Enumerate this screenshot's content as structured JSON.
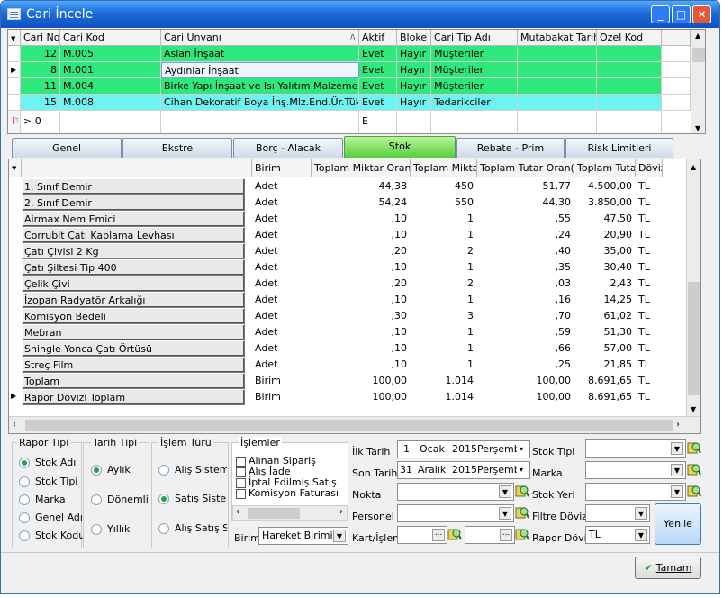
{
  "window": {
    "title": "Cari İncele",
    "minimize": "_",
    "maximize": "□",
    "close": "✕"
  },
  "top_grid": {
    "columns": [
      "Cari No",
      "Cari Kod",
      "Cari Ünvanı",
      "Aktif",
      "Bloke",
      "Cari Tip Adı",
      "Mutabakat Tarihi",
      "Özel Kod"
    ],
    "sort_indicator": "/\\",
    "rows": [
      {
        "no": "12",
        "kod": "M.005",
        "unvan": "Aslan İnşaat",
        "aktif": "Evet",
        "bloke": "Hayır",
        "tip": "Müşteriler",
        "color": "#2ee87c"
      },
      {
        "no": "8",
        "kod": "M.001",
        "unvan": "Aydınlar İnşaat",
        "aktif": "Evet",
        "bloke": "Hayır",
        "tip": "Müşteriler",
        "color": "#2ee87c"
      },
      {
        "no": "11",
        "kod": "M.004",
        "unvan": "Birke Yapı İnşaat ve Isı Yalıtım Malzemeleri",
        "aktif": "Evet",
        "bloke": "Hayır",
        "tip": "Müşteriler",
        "color": "#2ee87c"
      },
      {
        "no": "15",
        "kod": "M.008",
        "unvan": "Cihan Dekoratif Boya İnş.Mlz.End.Ür.Tük.Mal.",
        "aktif": "Evet",
        "bloke": "Hayır",
        "tip": "Tedarikciler",
        "color": "#6ff2f2"
      }
    ],
    "filter_row": {
      "no": "> 0",
      "aktif": "E"
    }
  },
  "tabs": [
    "Genel",
    "Ekstre",
    "Borç - Alacak",
    "Stok",
    "Rebate - Prim",
    "Risk Limitleri"
  ],
  "active_tab": "Stok",
  "stock_grid": {
    "columns": [
      "Birim",
      "Toplam Miktar Oran(%)",
      "Toplam Miktar",
      "Toplam Tutar Oran(%)",
      "Toplam Tutar",
      "Döviz"
    ],
    "rows": [
      {
        "name": "1. Sınıf Demir",
        "birim": "Adet",
        "moran": "44,38",
        "miktar": "450",
        "toran": "51,77",
        "tutar": "4.500,00",
        "doviz": "TL"
      },
      {
        "name": "2. Sınıf Demir",
        "birim": "Adet",
        "moran": "54,24",
        "miktar": "550",
        "toran": "44,30",
        "tutar": "3.850,00",
        "doviz": "TL"
      },
      {
        "name": "Airmax Nem Emici",
        "birim": "Adet",
        "moran": ",10",
        "miktar": "1",
        "toran": ",55",
        "tutar": "47,50",
        "doviz": "TL"
      },
      {
        "name": "Corrubit Çatı Kaplama Levhası",
        "birim": "Adet",
        "moran": ",10",
        "miktar": "1",
        "toran": ",24",
        "tutar": "20,90",
        "doviz": "TL"
      },
      {
        "name": "Çatı Çivisi 2 Kg",
        "birim": "Adet",
        "moran": ",20",
        "miktar": "2",
        "toran": ",40",
        "tutar": "35,00",
        "doviz": "TL"
      },
      {
        "name": "Çatı Şiltesi Tip 400",
        "birim": "Adet",
        "moran": ",10",
        "miktar": "1",
        "toran": ",35",
        "tutar": "30,40",
        "doviz": "TL"
      },
      {
        "name": "Çelik Çivi",
        "birim": "Adet",
        "moran": ",20",
        "miktar": "2",
        "toran": ",03",
        "tutar": "2,43",
        "doviz": "TL"
      },
      {
        "name": "İzopan Radyatör Arkalığı",
        "birim": "Adet",
        "moran": ",10",
        "miktar": "1",
        "toran": ",16",
        "tutar": "14,25",
        "doviz": "TL"
      },
      {
        "name": "Komisyon Bedeli",
        "birim": "Adet",
        "moran": ",30",
        "miktar": "3",
        "toran": ",70",
        "tutar": "61,02",
        "doviz": "TL"
      },
      {
        "name": "Mebran",
        "birim": "Adet",
        "moran": ",10",
        "miktar": "1",
        "toran": ",59",
        "tutar": "51,30",
        "doviz": "TL"
      },
      {
        "name": "Shingle Yonca Çatı Örtüsü",
        "birim": "Adet",
        "moran": ",10",
        "miktar": "1",
        "toran": ",66",
        "tutar": "57,00",
        "doviz": "TL"
      },
      {
        "name": "Streç Film",
        "birim": "Adet",
        "moran": ",10",
        "miktar": "1",
        "toran": ",25",
        "tutar": "21,85",
        "doviz": "TL"
      },
      {
        "name": "Toplam",
        "birim": "Birim",
        "moran": "100,00",
        "miktar": "1.014",
        "toran": "100,00",
        "tutar": "8.691,65",
        "doviz": "TL"
      },
      {
        "name": "Rapor Dövizi Toplam",
        "birim": "Birim",
        "moran": "100,00",
        "miktar": "1.014",
        "toran": "100,00",
        "tutar": "8.691,65",
        "doviz": "TL"
      }
    ]
  },
  "rapor_tipi": {
    "title": "Rapor Tipi",
    "options": [
      "Stok Adı",
      "Stok Tipi",
      "Marka",
      "Genel Adı",
      "Stok Kodu"
    ],
    "selected": "Stok Adı"
  },
  "tarih_tipi": {
    "title": "Tarih Tipi",
    "options": [
      "Aylık",
      "Dönemlik",
      "Yıllık"
    ],
    "selected": "Aylık"
  },
  "islem_turu": {
    "title": "İşlem Türü",
    "options": [
      "Alış Sistemi",
      "Satış Sistem",
      "Alış Satış Sis"
    ],
    "selected": "Satış Sistem"
  },
  "islemler": {
    "title": "İşlemler",
    "options": [
      "Alınan Sipariş",
      "Alış İade",
      "İptal Edilmiş Satış",
      "Komisyon Faturası"
    ]
  },
  "birim": {
    "label": "Birim",
    "value": "Hareket Birimi"
  },
  "filters": {
    "ilk_tarih_label": "İlk Tarih",
    "ilk_tarih": {
      "day": "1",
      "month": "Ocak",
      "year": "2015",
      "weekday": "Perşembe"
    },
    "son_tarih_label": "Son Tarih",
    "son_tarih": {
      "day": "31",
      "month": "Aralık",
      "year": "2015",
      "weekday": "Perşembe"
    },
    "nokta": "Nokta",
    "personel": "Personel",
    "kart_islem": "Kart/İşlem",
    "stok_tipi": "Stok Tipi",
    "marka": "Marka",
    "stok_yeri": "Stok Yeri",
    "filtre_dovizi": "Filtre Dövizi",
    "rapor_dovizi_label": "Rapor Dövizi",
    "rapor_dovizi": "TL",
    "ellipsis": "..."
  },
  "buttons": {
    "yenile": "Yenile",
    "tamam": "Tamam"
  },
  "colors": {
    "green_row": "#2ee87c",
    "cyan_row": "#6ff2f2",
    "active_tab": "#58cf3c",
    "titlebar": "#1c6cd6"
  }
}
